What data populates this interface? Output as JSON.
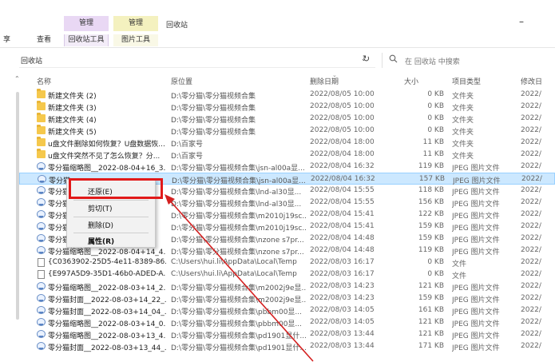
{
  "ribbon": {
    "context_tab_1": "管理",
    "context_tab_2": "管理",
    "window_title": "回收站",
    "minimize": "–",
    "tab_left": "享",
    "tab_view": "查看",
    "tab_recycle_tools": "回收站工具",
    "tab_picture_tools": "图片工具"
  },
  "address": {
    "path": "回收站",
    "dropdown": "⌄",
    "refresh": "↻"
  },
  "search": {
    "icon": "search-icon",
    "placeholder": "在 回收站 中搜索"
  },
  "columns": {
    "name": "名称",
    "original_location": "原位置",
    "date_deleted": "删除日期",
    "size": "大小",
    "item_type": "项目类型",
    "date_modified": "修改日"
  },
  "rows": [
    {
      "name": "新建文件夹 (2)",
      "orig": "D:\\零分猫\\零分猫视频合集",
      "date": "2022/08/05 10:00",
      "size": "0 KB",
      "type": "文件夹",
      "mod": "2022/",
      "icon": "folder"
    },
    {
      "name": "新建文件夹 (3)",
      "orig": "D:\\零分猫\\零分猫视频合集",
      "date": "2022/08/05 10:00",
      "size": "0 KB",
      "type": "文件夹",
      "mod": "2022/",
      "icon": "folder"
    },
    {
      "name": "新建文件夹 (4)",
      "orig": "D:\\零分猫\\零分猫视频合集",
      "date": "2022/08/05 10:00",
      "size": "0 KB",
      "type": "文件夹",
      "mod": "2022/",
      "icon": "folder"
    },
    {
      "name": "新建文件夹 (5)",
      "orig": "D:\\零分猫\\零分猫视频合集",
      "date": "2022/08/05 10:00",
      "size": "0 KB",
      "type": "文件夹",
      "mod": "2022/",
      "icon": "folder"
    },
    {
      "name": "u盘文件删除如何恢复？U盘数据恢...",
      "orig": "D:\\百家号",
      "date": "2022/08/04 18:00",
      "size": "11 KB",
      "type": "文件夹",
      "mod": "2022/",
      "icon": "folder"
    },
    {
      "name": "u盘文件突然不见了怎么恢复？分...",
      "orig": "D:\\百家号",
      "date": "2022/08/04 18:00",
      "size": "11 KB",
      "type": "文件夹",
      "mod": "2022/",
      "icon": "folder"
    },
    {
      "name": "零分猫缩略图__2022-08-04+16_3...",
      "orig": "D:\\零分猫\\零分猫视频合集\\jsn-al00a显...",
      "date": "2022/08/04 16:32",
      "size": "119 KB",
      "type": "JPEG 图片文件",
      "mod": "2022/",
      "icon": "img"
    },
    {
      "name": "零分猫",
      "orig": "D:\\零分猫\\零分猫视频合集\\jsn-al00a显...",
      "date": "2022/08/04 16:32",
      "size": "157 KB",
      "type": "JPEG 图片文件",
      "mod": "2022/",
      "icon": "img"
    },
    {
      "name": "零分猫",
      "orig": "D:\\零分猫\\零分猫视频合集\\lnd-al30显...",
      "date": "2022/08/04 15:55",
      "size": "118 KB",
      "type": "JPEG 图片文件",
      "mod": "2022/",
      "icon": "img"
    },
    {
      "name": "零分猫",
      "orig": "D:\\零分猫\\零分猫视频合集\\lnd-al30显...",
      "date": "2022/08/04 15:55",
      "size": "156 KB",
      "type": "JPEG 图片文件",
      "mod": "2022/",
      "icon": "img"
    },
    {
      "name": "零分猫",
      "orig": "D:\\零分猫\\零分猫视频合集\\m2010j19sc...",
      "date": "2022/08/04 15:41",
      "size": "122 KB",
      "type": "JPEG 图片文件",
      "mod": "2022/",
      "icon": "img"
    },
    {
      "name": "零分猫",
      "orig": "D:\\零分猫\\零分猫视频合集\\m2010j19sc...",
      "date": "2022/08/04 15:41",
      "size": "159 KB",
      "type": "JPEG 图片文件",
      "mod": "2022/",
      "icon": "img"
    },
    {
      "name": "零分猫",
      "orig": "D:\\零分猫\\零分猫视频合集\\nzone s7pr...",
      "date": "2022/08/04 14:48",
      "size": "159 KB",
      "type": "JPEG 图片文件",
      "mod": "2022/",
      "icon": "img"
    },
    {
      "name": "零分猫缩略图__2022-08-04+14_4...",
      "orig": "D:\\零分猫\\零分猫视频合集\\nzone s7pr...",
      "date": "2022/08/04 14:48",
      "size": "119 KB",
      "type": "JPEG 图片文件",
      "mod": "2022/",
      "icon": "img"
    },
    {
      "name": "{C0363902-25D5-4e11-8389-86...",
      "orig": "C:\\Users\\hui.li\\AppData\\Local\\Temp",
      "date": "2022/08/03 16:17",
      "size": "0 KB",
      "type": "文件",
      "mod": "2022/",
      "icon": "file"
    },
    {
      "name": "{E997A5D9-35D1-46b0-ADED-A...",
      "orig": "C:\\Users\\hui.li\\AppData\\Local\\Temp",
      "date": "2022/08/03 16:17",
      "size": "0 KB",
      "type": "文件",
      "mod": "2022/",
      "icon": "file"
    },
    {
      "name": "零分猫缩略图__2022-08-03+14_2...",
      "orig": "D:\\零分猫\\零分猫视频合集\\m2002j9e显...",
      "date": "2022/08/03 14:23",
      "size": "121 KB",
      "type": "JPEG 图片文件",
      "mod": "2022/",
      "icon": "img"
    },
    {
      "name": "零分猫封面__2022-08-03+14_22_...",
      "orig": "D:\\零分猫\\零分猫视频合集\\m2002j9e显...",
      "date": "2022/08/03 14:23",
      "size": "159 KB",
      "type": "JPEG 图片文件",
      "mod": "2022/",
      "icon": "img"
    },
    {
      "name": "零分猫封面__2022-08-03+14_04_...",
      "orig": "D:\\零分猫\\零分猫视频合集\\pbbm00显...",
      "date": "2022/08/03 14:05",
      "size": "161 KB",
      "type": "JPEG 图片文件",
      "mod": "2022/",
      "icon": "img"
    },
    {
      "name": "零分猫缩略图__2022-08-03+14_0...",
      "orig": "D:\\零分猫\\零分猫视频合集\\pbbm00显...",
      "date": "2022/08/03 14:05",
      "size": "121 KB",
      "type": "JPEG 图片文件",
      "mod": "2022/",
      "icon": "img"
    },
    {
      "name": "零分猫缩略图__2022-08-03+13_4...",
      "orig": "D:\\零分猫\\零分猫视频合集\\pd1901显什...",
      "date": "2022/08/03 13:44",
      "size": "121 KB",
      "type": "JPEG 图片文件",
      "mod": "2022/",
      "icon": "img"
    },
    {
      "name": "零分猫封面__2022-08-03+13_44_...",
      "orig": "D:\\零分猫\\零分猫视频合集\\pd1901显什...",
      "date": "2022/08/03 13:44",
      "size": "171 KB",
      "type": "JPEG 图片文件",
      "mod": "2022/",
      "icon": "img"
    }
  ],
  "selected_row": 7,
  "context_menu": {
    "restore": "还原(E)",
    "cut": "剪切(T)",
    "delete": "删除(D)",
    "properties": "属性(R)"
  },
  "annotation": {
    "highlight_color": "#e11a1a",
    "arrow_color": "#d42020"
  }
}
